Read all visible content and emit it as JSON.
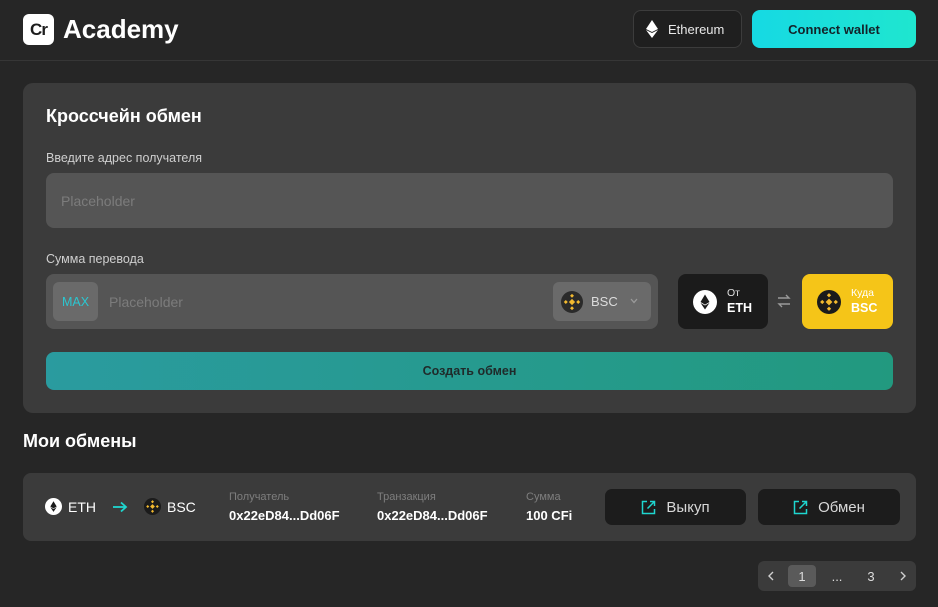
{
  "header": {
    "logo_badge": "Cr",
    "logo_text": "Academy",
    "network_label": "Ethereum",
    "network_icon": "ethereum-icon",
    "connect_label": "Connect wallet"
  },
  "exchange_form": {
    "title": "Кроссчейн обмен",
    "recipient_label": "Введите адрес получателя",
    "recipient_placeholder": "Placeholder",
    "amount_label": "Сумма перевода",
    "max_label": "MAX",
    "amount_placeholder": "Placeholder",
    "token_selected": "BSC",
    "from": {
      "caption": "От",
      "chain": "ETH"
    },
    "to": {
      "caption": "Куда",
      "chain": "BSC"
    },
    "create_label": "Создать обмен"
  },
  "my_exchanges": {
    "title": "Мои обмены",
    "rows": [
      {
        "from_chain": "ETH",
        "to_chain": "BSC",
        "recipient_label": "Получатель",
        "recipient": "0x22eD84...Dd06F",
        "tx_label": "Транзакция",
        "tx": "0x22eD84...Dd06F",
        "amount_label": "Сумма",
        "amount": "100 CFi",
        "redeem_label": "Выкуп",
        "exchange_label": "Обмен"
      }
    ]
  },
  "pagination": {
    "pages": [
      "1",
      "...",
      "3"
    ],
    "current": "1"
  },
  "colors": {
    "accent_cyan": "#16d9e3",
    "bsc_yellow": "#f5c518",
    "background": "#262626",
    "card": "#3b3b3b"
  }
}
